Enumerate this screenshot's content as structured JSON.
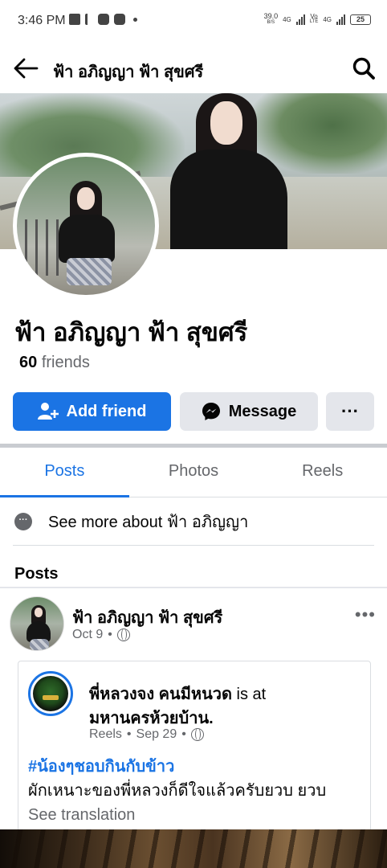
{
  "status_bar": {
    "time": "3:46 PM",
    "speed_value": "39.0",
    "speed_unit": "B/S",
    "net1": "4G",
    "net2_top": "Vo",
    "net2_bottom": "LTE",
    "net3": "4G",
    "battery": "25"
  },
  "top_bar": {
    "title": "ฟ้า อภิญญา ฟ้า สุขศรี"
  },
  "profile": {
    "name": "ฟ้า อภิญญา ฟ้า สุขศรี",
    "friends_count": "60",
    "friends_label": "friends",
    "add_friend_label": "Add friend",
    "message_label": "Message",
    "more_label": "···"
  },
  "tabs": [
    {
      "label": "Posts"
    },
    {
      "label": "Photos"
    },
    {
      "label": "Reels"
    }
  ],
  "see_more": "See more about ฟ้า อภิญญา",
  "posts_heading": "Posts",
  "post": {
    "author": "ฟ้า อภิญญา ฟ้า สุขศรี",
    "date": "Oct 9",
    "dot": "•",
    "more": "•••",
    "shared": {
      "author": "พี่หลวงจง คนมีหนวด",
      "is_at": " is at",
      "place": "มหานครห้วยบ้าน.",
      "source": "Reels",
      "date": "Sep 29",
      "dot1": "•",
      "dot2": "•",
      "hashtag": "#น้องๆชอบกินกับข้าว",
      "text": "ผักเหนาะของพี่หลวงก็ดีใจแล้วครับยวบ ยวบ",
      "see_translation": "See translation"
    }
  },
  "colors": {
    "accent": "#1b74e4",
    "secondary_button": "#e4e6eb",
    "muted_text": "#65676b"
  }
}
